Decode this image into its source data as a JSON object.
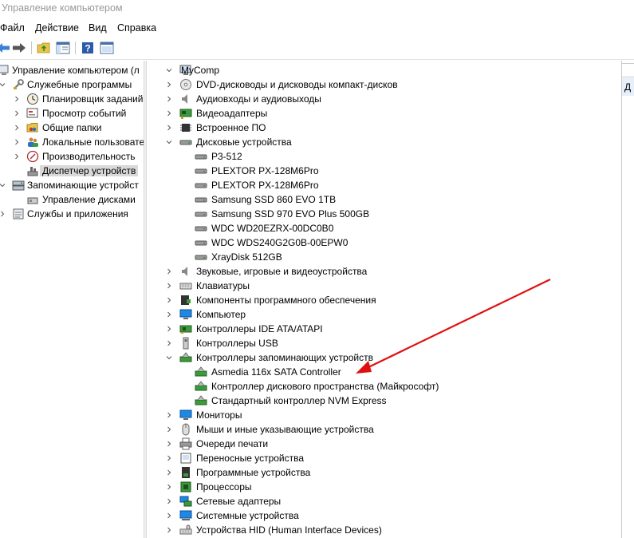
{
  "window": {
    "title": "Управление компьютером"
  },
  "menu": [
    "Файл",
    "Действие",
    "Вид",
    "Справка"
  ],
  "toolbar": {
    "icons": [
      "back-icon",
      "forward-icon",
      "up-folder-icon",
      "show-hide-tree-icon",
      "help-icon",
      "properties-icon"
    ]
  },
  "left_tree": {
    "root": "Управление компьютером (л",
    "system_tools": "Служебные программы",
    "task_scheduler": "Планировщик заданий",
    "event_viewer": "Просмотр событий",
    "shared_folders": "Общие папки",
    "local_users": "Локальные пользовате",
    "performance": "Производительность",
    "device_manager": "Диспетчер устройств",
    "storage": "Запоминающие устройст",
    "disk_management": "Управление дисками",
    "services": "Службы и приложения"
  },
  "device_tree": {
    "root": "MyComp",
    "dvd": "DVD-дисководы и дисководы компакт-дисков",
    "audio_io": "Аудиовходы и аудиовыходы",
    "video": "Видеоадаптеры",
    "firmware": "Встроенное ПО",
    "disks": "Дисковые устройства",
    "disk_items": [
      "P3-512",
      "PLEXTOR PX-128M6Pro",
      "PLEXTOR PX-128M6Pro",
      "Samsung SSD 860 EVO 1TB",
      "Samsung SSD 970 EVO Plus 500GB",
      "WDC WD20EZRX-00DC0B0",
      "WDC WDS240G2G0B-00EPW0",
      "XrayDisk 512GB"
    ],
    "sound": "Звуковые, игровые и видеоустройства",
    "keyboards": "Клавиатуры",
    "software_components": "Компоненты программного обеспечения",
    "computer": "Компьютер",
    "ide": "Контроллеры IDE ATA/ATAPI",
    "usb": "Контроллеры USB",
    "storage_controllers": "Контроллеры запоминающих устройств",
    "storage_items": [
      "Asmedia 116x SATA Controller",
      "Контроллер дискового пространства (Майкрософт)",
      "Стандартный контроллер NVM Express"
    ],
    "monitors": "Мониторы",
    "mice": "Мыши и иные указывающие устройства",
    "print_queues": "Очереди печати",
    "portable": "Переносные устройства",
    "software_devices": "Программные устройства",
    "processors": "Процессоры",
    "network": "Сетевые адаптеры",
    "system_devices": "Системные устройства",
    "hid": "Устройства HID (Human Interface Devices)"
  },
  "right_pane": {
    "header_letter": "Д"
  },
  "colors": {
    "annotation_arrow": "#e01010",
    "selection": "#d9d9d9"
  }
}
